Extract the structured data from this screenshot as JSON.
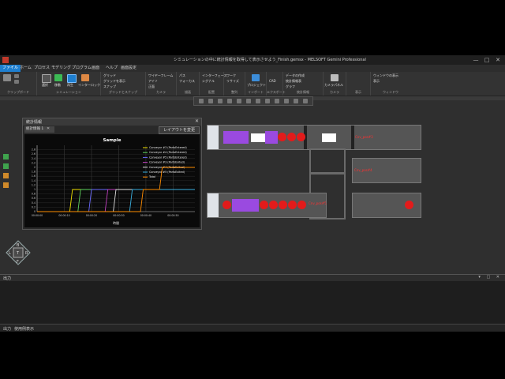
{
  "window": {
    "title": "シミュレーションの中に統計情報を取得して表示させよう_Finish.gemsx - MELSOFT Gemini Professional",
    "controls": [
      "—",
      "□",
      "✕"
    ]
  },
  "menu": [
    {
      "label": "ファイル",
      "active": true
    },
    {
      "label": "ホーム",
      "active": false
    },
    {
      "label": "プロセス",
      "active": false
    },
    {
      "label": "モデリング",
      "active": false
    },
    {
      "label": "プログラム",
      "active": false
    },
    {
      "label": "画面",
      "active": false
    },
    {
      "label": "ヘルプ",
      "active": false
    },
    {
      "label": "画面設定",
      "active": false
    }
  ],
  "ribbon": {
    "groups": [
      {
        "label": "クリップボード"
      },
      {
        "label": "シミュレーション"
      },
      {
        "label": "グリッドとスナップ"
      },
      {
        "label": "カメラ"
      },
      {
        "label": "描画"
      },
      {
        "label": "配置"
      },
      {
        "label": "整列"
      },
      {
        "label": "インポート"
      },
      {
        "label": "エクスポート"
      },
      {
        "label": "統計情報"
      },
      {
        "label": "カメラ"
      },
      {
        "label": "表示"
      },
      {
        "label": "ウィンドウ"
      }
    ],
    "items": {
      "sim_select": "選択",
      "sim_move": "移動",
      "sim_play": "再生",
      "interlock": "インターロック",
      "grid": "グリッド",
      "show_grid": "グリッドを表示",
      "snap": "スナップ",
      "wireframe": "ワイヤーフレーム",
      "isometric": "アイソ",
      "front": "正面",
      "path_left": "パス",
      "focus": "フォーカス",
      "interface": "インターフェース",
      "signal": "シグナル",
      "workarea": "ワーク",
      "resize": "リサイズ",
      "project": "プロジェクト",
      "cad": "CAD",
      "stats_create": "データの作成",
      "stats_table": "統計情報表",
      "stats_graph": "グラフ",
      "camera_panel": "カメラパネル",
      "win_all": "ウィンドウの表示",
      "win_show": "表示"
    }
  },
  "stats_window": {
    "title": "統計情報",
    "tab_label": "統計情報 1",
    "layout_button": "レイアウトを変更",
    "close": "✕"
  },
  "chart_data": {
    "type": "line",
    "title": "Sample",
    "xlabel": "時間",
    "ylabel": "",
    "x_ticks": [
      "00:00:00",
      "00:00:10",
      "00:00:20",
      "00:00:30",
      "00:00:40",
      "00:00:50"
    ],
    "y_ticks": [
      0,
      0.2,
      0.4,
      0.6,
      0.8,
      1,
      1.2,
      1.4,
      1.6,
      1.8,
      2,
      2.2,
      2.4,
      2.6,
      2.8
    ],
    "xlim": [
      0,
      58
    ],
    "ylim": [
      0,
      3
    ],
    "grid": true,
    "legend_position": "top-right",
    "series": [
      {
        "name": "Conveyor #3 (PartsEntered)",
        "color": "#f0e000",
        "x": [
          0,
          12,
          13,
          20,
          30,
          40,
          50,
          58
        ],
        "y": [
          0,
          0,
          1,
          1,
          1,
          1,
          1,
          1
        ]
      },
      {
        "name": "Conveyor #4 (PartsEntered)",
        "color": "#5fd45f",
        "x": [
          0,
          15,
          16,
          58
        ],
        "y": [
          0,
          0,
          1,
          1
        ]
      },
      {
        "name": "Conveyor #5 (PartsEntered)",
        "color": "#6a6aff",
        "x": [
          0,
          19,
          20,
          58
        ],
        "y": [
          0,
          0,
          1,
          1
        ]
      },
      {
        "name": "Conveyor #3 (PartsExited)",
        "color": "#c040c0",
        "x": [
          0,
          25,
          26,
          58
        ],
        "y": [
          0,
          0,
          1,
          1
        ]
      },
      {
        "name": "Conveyor #4 (PartsExited)",
        "color": "#e0e0e0",
        "x": [
          0,
          28,
          29,
          58
        ],
        "y": [
          0,
          0,
          1,
          1
        ]
      },
      {
        "name": "Conveyor #5 (PartsExited)",
        "color": "#3ab0e0",
        "x": [
          0,
          34,
          35,
          58
        ],
        "y": [
          0,
          0,
          1,
          1
        ]
      },
      {
        "name": "Total",
        "color": "#ff8c00",
        "x": [
          0,
          38,
          39,
          45,
          46,
          58
        ],
        "y": [
          0,
          0,
          1,
          1,
          2,
          2
        ]
      }
    ]
  },
  "scene": {
    "conveyor_labels": [
      "Cnv_pos#3",
      "Cnv_pos#4",
      "Cnv_pos#5"
    ]
  },
  "output_panel": {
    "title": "出力",
    "controls": "▾ □ ✕"
  },
  "statusbar": {
    "tabs": [
      "出力",
      "使用例表示"
    ]
  },
  "colors": {
    "accent": "#1e7fd0",
    "part_purple": "#9a4ae0",
    "part_red": "#e31b1b"
  }
}
